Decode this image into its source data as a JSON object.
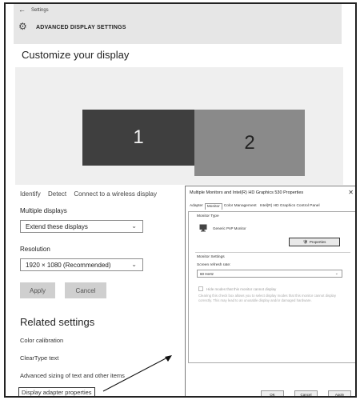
{
  "header": {
    "back_glyph": "←",
    "breadcrumb": "Settings",
    "gear_glyph": "⚙",
    "title": "ADVANCED DISPLAY SETTINGS"
  },
  "customize": {
    "heading": "Customize your display",
    "monitor_1": "1",
    "monitor_2": "2"
  },
  "links": {
    "identify": "Identify",
    "detect": "Detect",
    "wireless": "Connect to a wireless display"
  },
  "multiple_displays": {
    "label": "Multiple displays",
    "value": "Extend these displays"
  },
  "resolution": {
    "label": "Resolution",
    "value": "1920 × 1080 (Recommended)"
  },
  "buttons": {
    "apply": "Apply",
    "cancel": "Cancel"
  },
  "related": {
    "heading": "Related settings",
    "color_calibration": "Color calibration",
    "cleartype": "ClearType text",
    "advanced_sizing": "Advanced sizing of text and other items",
    "adapter_properties": "Display adapter properties"
  },
  "dialog": {
    "title": "Multiple Monitors and Intel(R) HD Graphics 530 Properties",
    "close_glyph": "✕",
    "tabs": [
      "Adapter",
      "Monitor",
      "Color Management",
      "Intel(R) HD Graphics Control Panel"
    ],
    "active_tab": "Monitor",
    "monitor_type_label": "Monitor Type",
    "monitor_name": "Generic PnP Monitor",
    "properties_button": "Properties",
    "monitor_settings_label": "Monitor Settings",
    "refresh_rate_label": "Screen refresh rate:",
    "refresh_rate_value": "60 Hertz",
    "hide_modes_label": "Hide modes that this monitor cannot display",
    "hint": "Clearing this check box allows you to select display modes that this monitor cannot display correctly. This may lead to an unusable display and/or damaged hardware.",
    "ok": "OK",
    "cancel": "Cancel",
    "apply": "Apply"
  },
  "colors": {
    "monitor_1": "#3f3f3f",
    "monitor_2": "#8a8a8a",
    "header_bg": "#e6e6e6"
  }
}
